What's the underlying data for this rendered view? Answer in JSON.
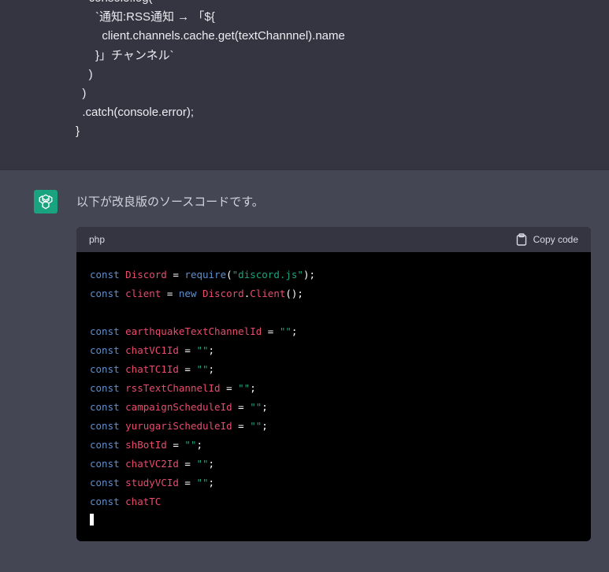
{
  "user_message": {
    "lines": [
      "    console.log(",
      "      `通知:RSS通知 → 「${",
      "        client.channels.cache.get(textChannnel).name",
      "      }」チャンネル`",
      "    )",
      "  )",
      "  .catch(console.error);",
      "}"
    ]
  },
  "assistant": {
    "intro": "以下が改良版のソースコードです。",
    "code_block": {
      "language": "php",
      "copy_label": "Copy code",
      "lines": [
        [
          {
            "t": "kw",
            "v": "const "
          },
          {
            "t": "id",
            "v": "Discord"
          },
          {
            "t": "op",
            "v": " = "
          },
          {
            "t": "kw",
            "v": "require"
          },
          {
            "t": "op",
            "v": "("
          },
          {
            "t": "str",
            "v": "\"discord.js\""
          },
          {
            "t": "op",
            "v": ");"
          }
        ],
        [
          {
            "t": "kw",
            "v": "const "
          },
          {
            "t": "id",
            "v": "client"
          },
          {
            "t": "op",
            "v": " = "
          },
          {
            "t": "kw",
            "v": "new "
          },
          {
            "t": "id",
            "v": "Discord"
          },
          {
            "t": "op",
            "v": "."
          },
          {
            "t": "id",
            "v": "Client"
          },
          {
            "t": "op",
            "v": "();"
          }
        ],
        [],
        [
          {
            "t": "kw",
            "v": "const "
          },
          {
            "t": "id",
            "v": "earthquakeTextChannelId"
          },
          {
            "t": "op",
            "v": " = "
          },
          {
            "t": "str",
            "v": "\"\""
          },
          {
            "t": "op",
            "v": ";"
          }
        ],
        [
          {
            "t": "kw",
            "v": "const "
          },
          {
            "t": "id",
            "v": "chatVC1Id"
          },
          {
            "t": "op",
            "v": " = "
          },
          {
            "t": "str",
            "v": "\"\""
          },
          {
            "t": "op",
            "v": ";"
          }
        ],
        [
          {
            "t": "kw",
            "v": "const "
          },
          {
            "t": "id",
            "v": "chatTC1Id"
          },
          {
            "t": "op",
            "v": " = "
          },
          {
            "t": "str",
            "v": "\"\""
          },
          {
            "t": "op",
            "v": ";"
          }
        ],
        [
          {
            "t": "kw",
            "v": "const "
          },
          {
            "t": "id",
            "v": "rssTextChannelId"
          },
          {
            "t": "op",
            "v": " = "
          },
          {
            "t": "str",
            "v": "\"\""
          },
          {
            "t": "op",
            "v": ";"
          }
        ],
        [
          {
            "t": "kw",
            "v": "const "
          },
          {
            "t": "id",
            "v": "campaignScheduleId"
          },
          {
            "t": "op",
            "v": " = "
          },
          {
            "t": "str",
            "v": "\"\""
          },
          {
            "t": "op",
            "v": ";"
          }
        ],
        [
          {
            "t": "kw",
            "v": "const "
          },
          {
            "t": "id",
            "v": "yurugariScheduleId"
          },
          {
            "t": "op",
            "v": " = "
          },
          {
            "t": "str",
            "v": "\"\""
          },
          {
            "t": "op",
            "v": ";"
          }
        ],
        [
          {
            "t": "kw",
            "v": "const "
          },
          {
            "t": "id",
            "v": "shBotId"
          },
          {
            "t": "op",
            "v": " = "
          },
          {
            "t": "str",
            "v": "\"\""
          },
          {
            "t": "op",
            "v": ";"
          }
        ],
        [
          {
            "t": "kw",
            "v": "const "
          },
          {
            "t": "id",
            "v": "chatVC2Id"
          },
          {
            "t": "op",
            "v": " = "
          },
          {
            "t": "str",
            "v": "\"\""
          },
          {
            "t": "op",
            "v": ";"
          }
        ],
        [
          {
            "t": "kw",
            "v": "const "
          },
          {
            "t": "id",
            "v": "studyVCId"
          },
          {
            "t": "op",
            "v": " = "
          },
          {
            "t": "str",
            "v": "\"\""
          },
          {
            "t": "op",
            "v": ";"
          }
        ],
        [
          {
            "t": "kw",
            "v": "const "
          },
          {
            "t": "id",
            "v": "chatTC"
          }
        ]
      ]
    }
  },
  "colors": {
    "keyword": "#5f8fcf",
    "identifier": "#e84c6e",
    "string": "#1aa57f",
    "avatar": "#19a37f"
  },
  "icons": {
    "avatar": "openai-logo-icon",
    "copy": "clipboard-icon"
  }
}
